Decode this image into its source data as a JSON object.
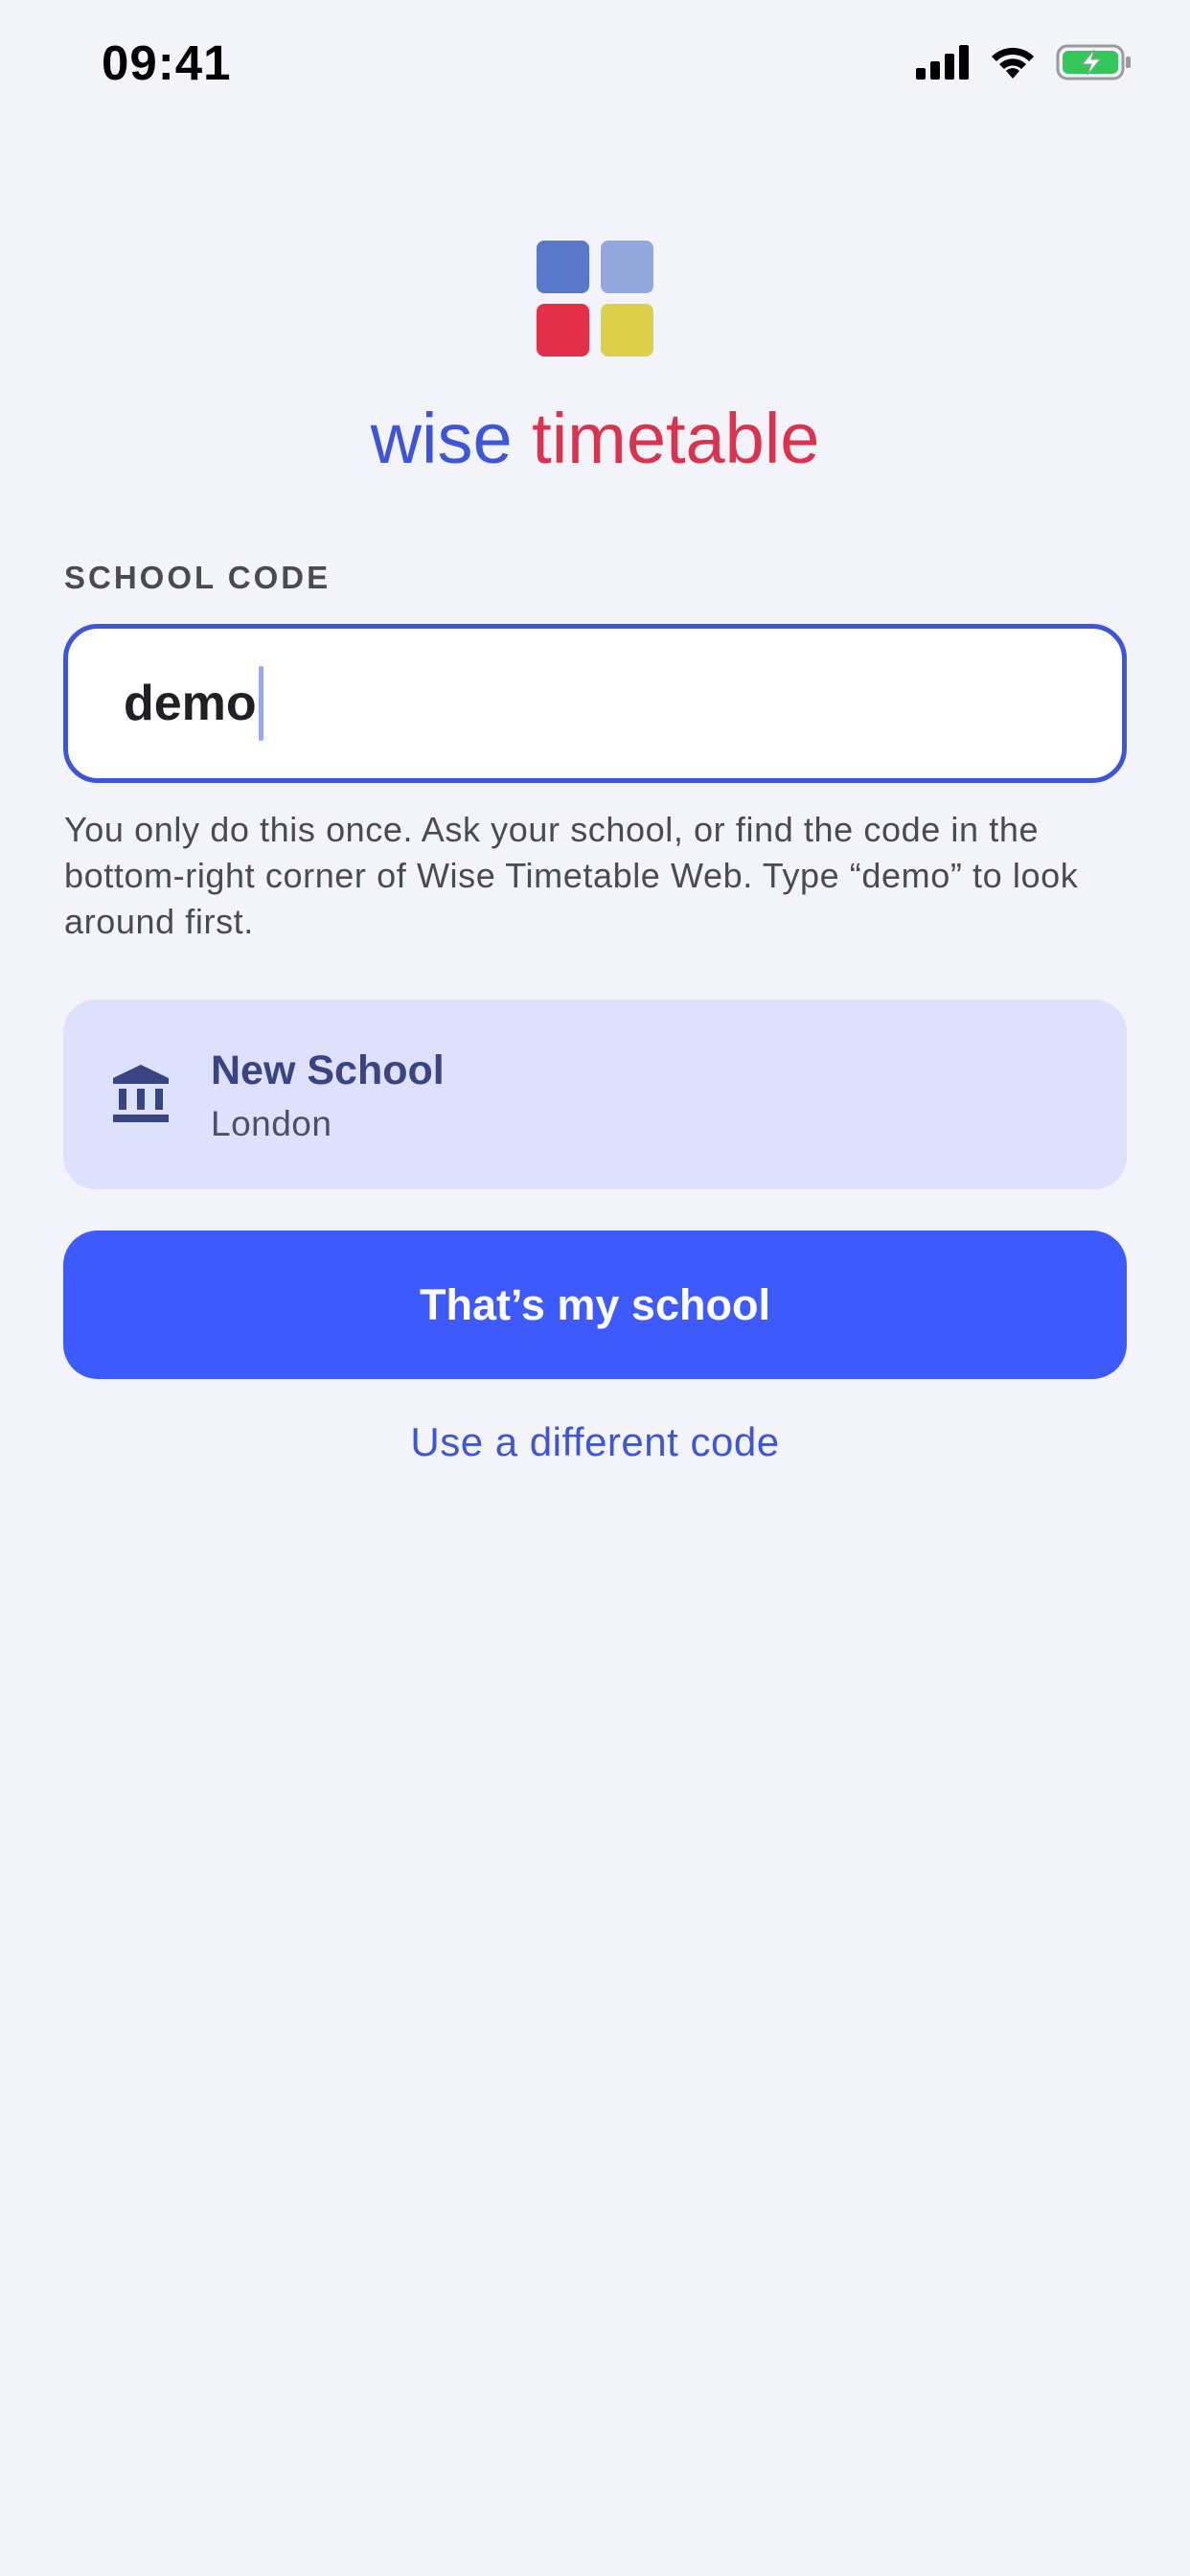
{
  "status_bar": {
    "time": "09:41",
    "icons": [
      "cellular-signal-icon",
      "wifi-icon",
      "battery-charging-icon"
    ]
  },
  "brand": {
    "word1": "wise",
    "word2": "timetable",
    "colors": {
      "word1": "#3f55d8",
      "word2": "#d9334f",
      "tile_top_left": "#5a78c9",
      "tile_top_right": "#93a7dc",
      "tile_bottom_left": "#e3304a",
      "tile_bottom_right": "#dccf4a"
    }
  },
  "form": {
    "label": "SCHOOL CODE",
    "code_value": "demo",
    "help_text": "You only do this once. Ask your school, or find the code in the bottom-right corner of Wise Timetable Web. Type “demo” to look around first."
  },
  "school_result": {
    "icon": "school-building-icon",
    "name": "New School",
    "city": "London"
  },
  "actions": {
    "confirm_label": "That’s my school",
    "alt_label": "Use a different code"
  },
  "colors": {
    "accent": "#3d5afe",
    "card_bg": "#dde1fc",
    "page_bg": "#f3f4f9"
  }
}
